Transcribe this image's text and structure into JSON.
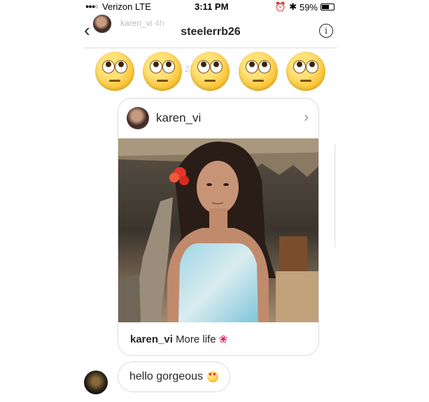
{
  "status_bar": {
    "carrier": "Verizon  LTE",
    "time": "3:11 PM",
    "battery": "59%"
  },
  "header": {
    "story_username": "karen_vi",
    "story_age": "4h",
    "title": "steelerrb26"
  },
  "reactions": {
    "emoji_count": 5,
    "emoji_name": "face-with-rolling-eyes",
    "timestamp_partial": "27",
    "timestamp_partial_2": "4"
  },
  "shared_post": {
    "username": "karen_vi",
    "caption_user": "karen_vi",
    "caption_text": "More life"
  },
  "message": {
    "text": "hello gorgeous"
  },
  "colors": {
    "border": "#dbdbdb",
    "text": "#262626",
    "secondary": "#8e8e8e"
  }
}
